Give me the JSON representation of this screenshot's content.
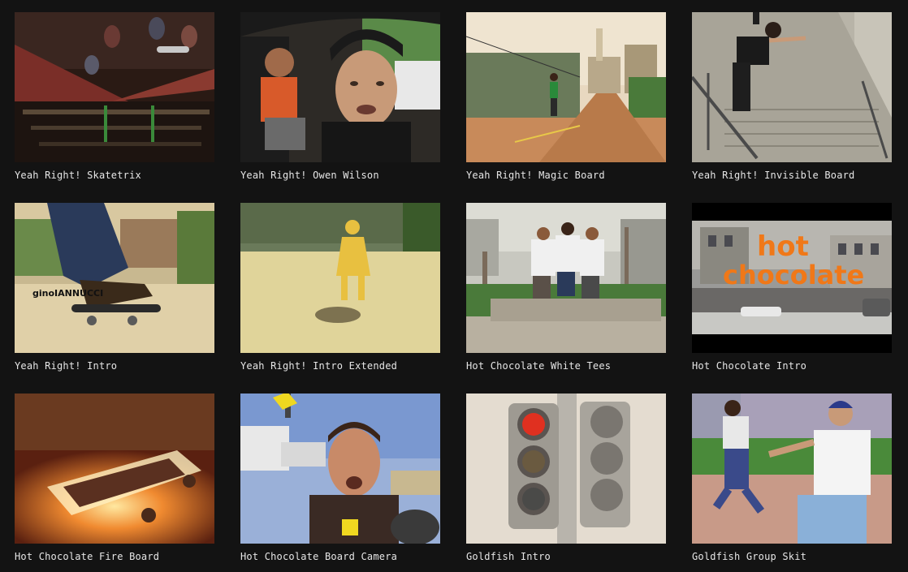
{
  "videos": [
    {
      "title": "Yeah Right! Skatetrix",
      "thumbnail": "skaters-stadium-thumbnail"
    },
    {
      "title": "Yeah Right! Owen Wilson",
      "thumbnail": "car-selfie-thumbnail"
    },
    {
      "title": "Yeah Right! Magic Board",
      "thumbnail": "city-street-thumbnail"
    },
    {
      "title": "Yeah Right! Invisible Board",
      "thumbnail": "handrail-stairs-thumbnail"
    },
    {
      "title": "Yeah Right! Intro",
      "thumbnail": "skateboard-closeup-thumbnail"
    },
    {
      "title": "Yeah Right! Intro Extended",
      "thumbnail": "girl-logo-figure-thumbnail"
    },
    {
      "title": "Hot Chocolate White Tees",
      "thumbnail": "group-grind-thumbnail"
    },
    {
      "title": "Hot Chocolate Intro",
      "thumbnail": "hot-chocolate-logo-thumbnail"
    },
    {
      "title": "Hot Chocolate Fire Board",
      "thumbnail": "fire-board-thumbnail"
    },
    {
      "title": "Hot Chocolate Board Camera",
      "thumbnail": "board-camera-thumbnail"
    },
    {
      "title": "Goldfish Intro",
      "thumbnail": "traffic-light-thumbnail"
    },
    {
      "title": "Goldfish Group Skit",
      "thumbnail": "group-skit-thumbnail"
    }
  ],
  "overlay_text": {
    "skater_name": "ginoIANNUCCI",
    "logo_line1": "hot",
    "logo_line2": "chocolate"
  }
}
